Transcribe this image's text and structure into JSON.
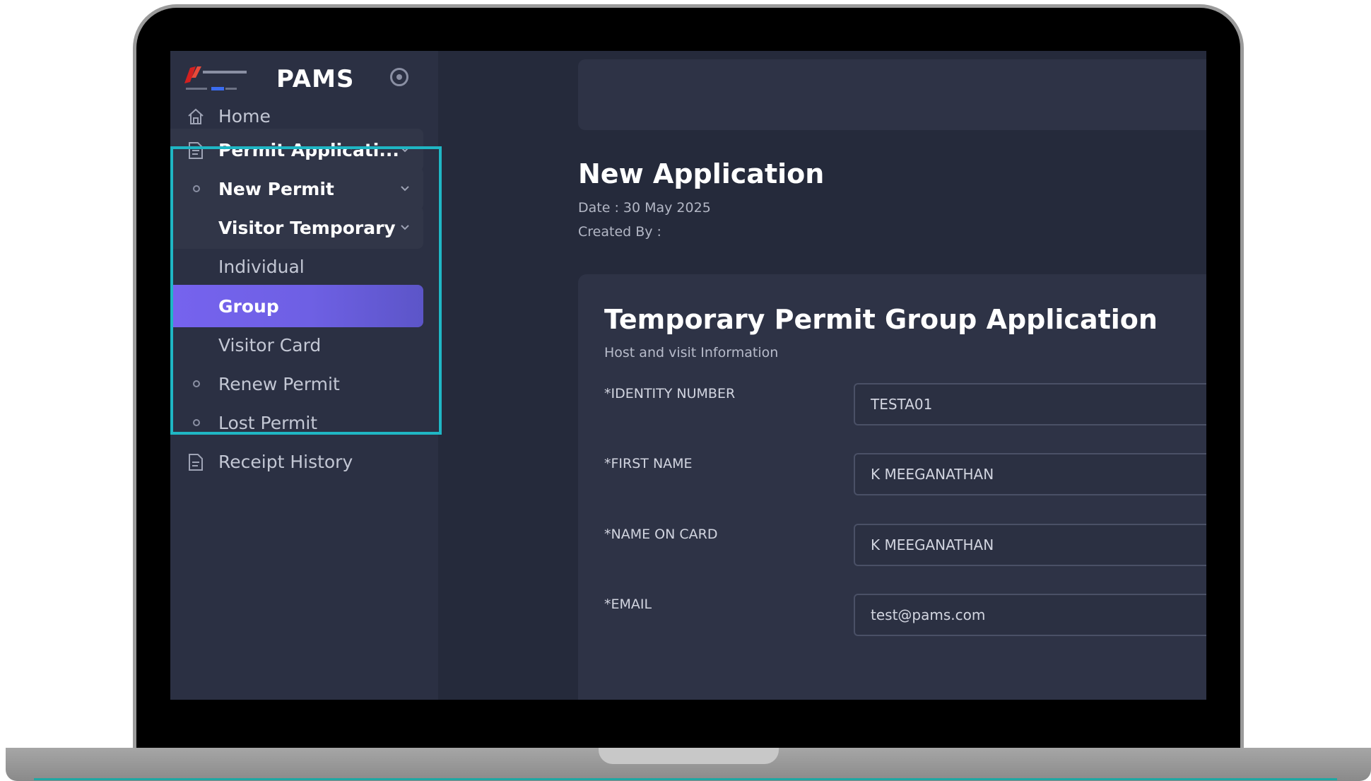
{
  "app": {
    "name": "PAMS",
    "logo_text": "PAMS"
  },
  "sidebar": {
    "items": [
      {
        "label": "Home",
        "icon": "home-icon"
      },
      {
        "label": "Permit Applicati...",
        "icon": "document-icon"
      },
      {
        "label": "New Permit",
        "icon": "circle-bullet-icon"
      },
      {
        "label": "Visitor Temporary"
      },
      {
        "label": "Individual"
      },
      {
        "label": "Group"
      },
      {
        "label": "Visitor Card"
      },
      {
        "label": "Renew Permit",
        "icon": "circle-bullet-icon"
      },
      {
        "label": "Lost Permit",
        "icon": "circle-bullet-icon"
      },
      {
        "label": "Receipt History",
        "icon": "document-icon"
      }
    ]
  },
  "main": {
    "title": "New Application",
    "date": "Date : 30 May 2025",
    "created_by": "Created By :",
    "form": {
      "title": "Temporary Permit Group Application",
      "subtitle": "Host and visit Information",
      "fields": [
        {
          "label": "*IDENTITY NUMBER",
          "value": "TESTA01"
        },
        {
          "label": "*FIRST NAME",
          "value": "K MEEGANATHAN"
        },
        {
          "label": "*NAME ON CARD",
          "value": "K MEEGANATHAN"
        },
        {
          "label": "*EMAIL",
          "value": "test@pams.com"
        }
      ]
    }
  },
  "colors": {
    "accent": "#7663ee",
    "highlight": "#1fb6c4",
    "sidebar_bg": "#2b3043",
    "screen_bg": "#252a3b"
  }
}
